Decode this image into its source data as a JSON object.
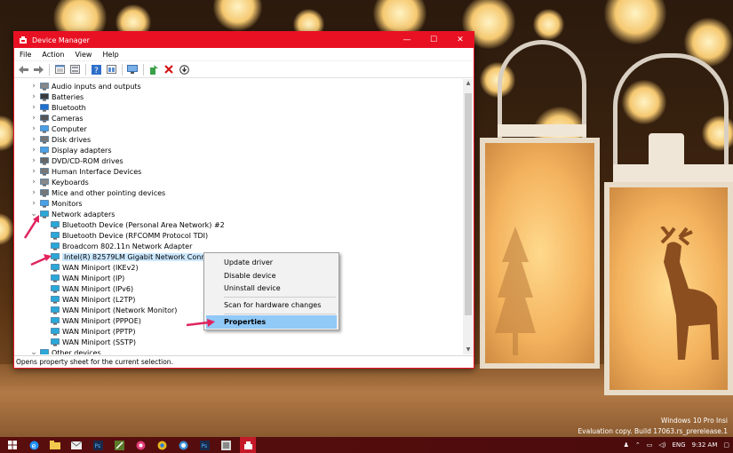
{
  "window": {
    "title": "Device Manager",
    "minimize": "—",
    "maximize": "☐",
    "close": "✕",
    "accent": "#e81123"
  },
  "menu": [
    "File",
    "Action",
    "View",
    "Help"
  ],
  "toolbar": [
    "back-icon",
    "forward-icon",
    "properties-icon",
    "show-hidden-icon",
    "help-icon",
    "view-icon",
    "scan-hardware-icon",
    "update-driver-icon",
    "uninstall-icon",
    "disable-icon"
  ],
  "tree": {
    "categories_top": [
      "Audio inputs and outputs",
      "Batteries",
      "Bluetooth",
      "Cameras",
      "Computer",
      "Disk drives",
      "Display adapters",
      "DVD/CD-ROM drives",
      "Human Interface Devices",
      "Keyboards",
      "Mice and other pointing devices",
      "Monitors",
      "Network adapters"
    ],
    "network_children": [
      "Bluetooth Device (Personal Area Network) #2",
      "Bluetooth Device (RFCOMM Protocol TDI)",
      "Broadcom 802.11n Network Adapter",
      "Intel(R) 82579LM Gigabit Network Connection",
      "WAN Miniport (IKEv2)",
      "WAN Miniport (IP)",
      "WAN Miniport (IPv6)",
      "WAN Miniport (L2TP)",
      "WAN Miniport (Network Monitor)",
      "WAN Miniport (PPPOE)",
      "WAN Miniport (PPTP)",
      "WAN Miniport (SSTP)"
    ],
    "categories_bottom": [
      "Other devices"
    ]
  },
  "context_menu": {
    "items": [
      "Update driver",
      "Disable device",
      "Uninstall device",
      "Scan for hardware changes",
      "Properties"
    ],
    "highlighted": "Properties",
    "highlight_color": "#91c9f7"
  },
  "status": "Opens property sheet for the current selection.",
  "desktop": {
    "watermark_line1": "Windows 10 Pro Insi",
    "watermark_line2": "Evaluation copy. Build 17063.rs_prerelease.1"
  },
  "tray": {
    "language": "ENG",
    "time": "9:32 AM"
  }
}
